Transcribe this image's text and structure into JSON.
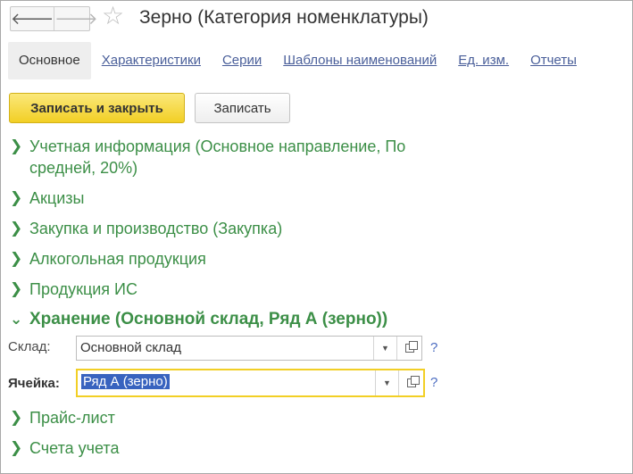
{
  "window": {
    "title": "Зерно (Категория номенклатуры)",
    "back_glyph": "🡐",
    "forward_glyph": "🡒",
    "favorite_glyph": "☆"
  },
  "tabs": [
    {
      "label": "Основное",
      "active": true
    },
    {
      "label": "Характеристики",
      "active": false
    },
    {
      "label": "Серии",
      "active": false
    },
    {
      "label": "Шаблоны наименований",
      "active": false
    },
    {
      "label": "Ед. изм.",
      "active": false
    },
    {
      "label": "Отчеты",
      "active": false
    }
  ],
  "commands": {
    "save_close_label": "Записать и закрыть",
    "save_label": "Записать"
  },
  "groups": [
    {
      "label": "Учетная информация (Основное направление, По средней, 20%)",
      "expanded": false
    },
    {
      "label": "Акцизы",
      "expanded": false
    },
    {
      "label": "Закупка и производство (Закупка)",
      "expanded": false
    },
    {
      "label": "Алкогольная продукция",
      "expanded": false
    },
    {
      "label": "Продукция ИС",
      "expanded": false
    },
    {
      "label": "Хранение (Основной склад, Ряд А (зерно))",
      "expanded": true
    },
    {
      "label": "Прайс-лист",
      "expanded": false
    },
    {
      "label": "Счета учета",
      "expanded": false
    }
  ],
  "storage": {
    "warehouse_label": "Склад:",
    "warehouse_value": "Основной склад",
    "cell_label": "Ячейка:",
    "cell_value": "Ряд А (зерно)",
    "help_glyph": "?",
    "dropdown_glyph": "▼"
  },
  "icons": {
    "collapsed": "chevron-right-icon",
    "expanded": "chevron-down-icon",
    "open": "open-form-icon"
  },
  "colors": {
    "accent_yellow": "#f2cf25",
    "group_green": "#3c8f47",
    "link_blue": "#4a5f9a",
    "selection_blue": "#3863bf"
  }
}
